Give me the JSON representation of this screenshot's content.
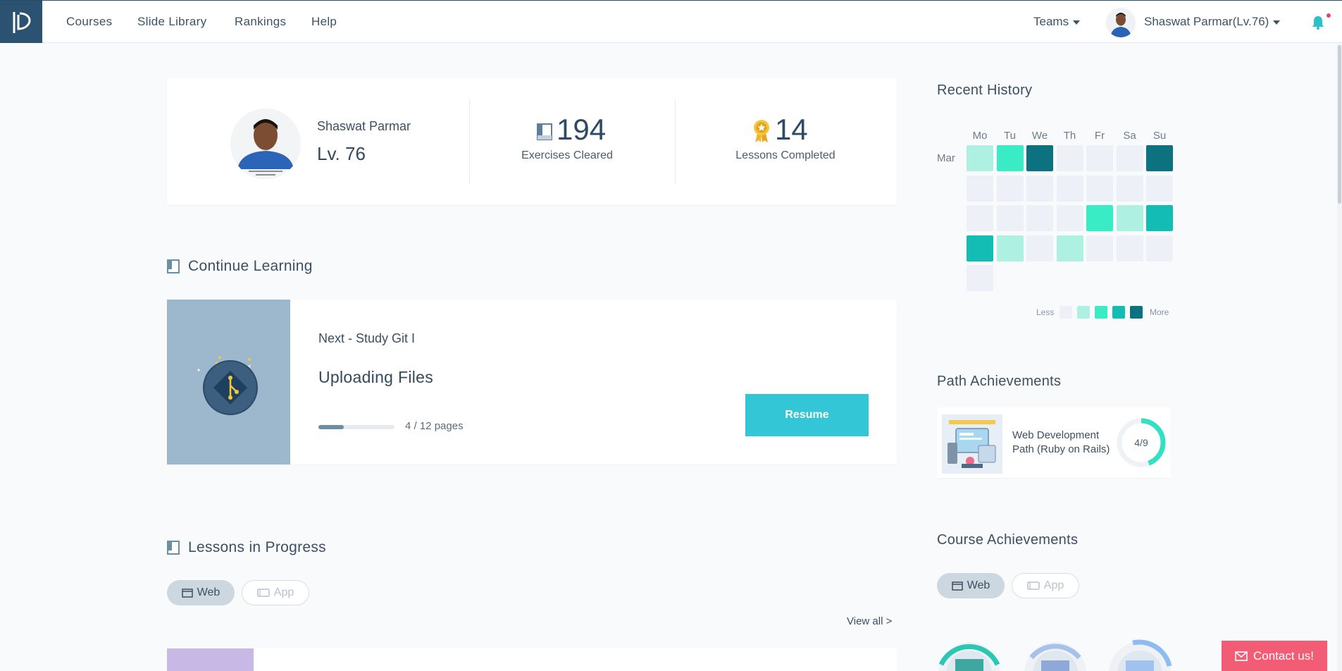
{
  "nav": {
    "links": [
      "Courses",
      "Slide Library",
      "Rankings",
      "Help"
    ],
    "teams_label": "Teams",
    "user_label": "Shaswat Parmar(Lv.76)"
  },
  "profile": {
    "name": "Shaswat Parmar",
    "level": "Lv. 76",
    "exercises_count": "194",
    "exercises_label": "Exercises Cleared",
    "lessons_count": "14",
    "lessons_label": "Lessons Completed"
  },
  "continue_learning": {
    "heading": "Continue Learning",
    "next_label": "Next - Study Git I",
    "lesson_title": "Uploading Files",
    "pages_text": "4 / 12 pages",
    "progress_fraction": 0.33,
    "resume_label": "Resume"
  },
  "lessons_in_progress": {
    "heading": "Lessons in Progress",
    "tabs": [
      "Web",
      "App"
    ],
    "view_all_label": "View all >"
  },
  "recent_history": {
    "heading": "Recent History",
    "days": [
      "Mo",
      "Tu",
      "We",
      "Th",
      "Fr",
      "Sa",
      "Su"
    ],
    "month": "Mar",
    "weeks": [
      [
        1,
        2,
        4,
        0,
        0,
        0,
        4
      ],
      [
        0,
        0,
        0,
        0,
        0,
        0,
        0
      ],
      [
        0,
        0,
        0,
        0,
        2,
        1,
        3
      ],
      [
        3,
        1,
        0,
        1,
        0,
        0,
        0
      ],
      [
        0
      ]
    ],
    "legend_less": "Less",
    "legend_more": "More",
    "level_colors": [
      "#edf1f7",
      "#aef0e1",
      "#39ecc6",
      "#14bdb3",
      "#0c7280"
    ]
  },
  "path_achievements": {
    "heading": "Path Achievements",
    "name": "Web Development Path (Ruby on Rails)",
    "progress_text": "4/9",
    "progress_fraction": 0.444
  },
  "course_achievements": {
    "heading": "Course Achievements",
    "tabs": [
      "Web",
      "App"
    ]
  },
  "contact_label": "Contact us!"
}
